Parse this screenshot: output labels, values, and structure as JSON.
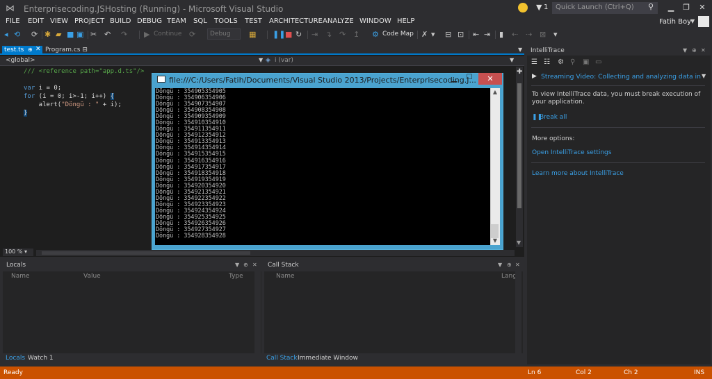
{
  "window": {
    "title": "Enterprisecoding.JSHosting (Running) - Microsoft Visual Studio",
    "notification_count": "1",
    "quick_launch_placeholder": "Quick Launch (Ctrl+Q)",
    "user": "Fatih Boy"
  },
  "menu": [
    "FILE",
    "EDIT",
    "VIEW",
    "PROJECT",
    "BUILD",
    "DEBUG",
    "TEAM",
    "SQL",
    "TOOLS",
    "TEST",
    "ARCHITECTURE",
    "ANALYZE",
    "WINDOW",
    "HELP"
  ],
  "toolbar": {
    "continue_label": "Continue",
    "config_value": "Debug",
    "code_map_label": "Code Map"
  },
  "editor": {
    "tabs": [
      {
        "label": "test.ts",
        "active": true
      },
      {
        "label": "Program.cs",
        "active": false
      }
    ],
    "nav_left": "<global>",
    "nav_right": "i (var)",
    "code_lines": [
      "/// <reference path=\"app.d.ts\"/>",
      "",
      "var i = 0;",
      "for (i = 0; i>-1; i++) {",
      "    alert(\"Döngü : \" + i);",
      "}"
    ],
    "zoom": "100 %"
  },
  "console": {
    "title": "file:///C:/Users/Fatih/Documents/Visual Studio 2013/Projects/Enterprisecoding.J...",
    "lines": [
      "Döngü : 354905354905",
      "Döngü : 354906354906",
      "Döngü : 354907354907",
      "Döngü : 354908354908",
      "Döngü : 354909354909",
      "Döngü : 354910354910",
      "Döngü : 354911354911",
      "Döngü : 354912354912",
      "Döngü : 354913354913",
      "Döngü : 354914354914",
      "Döngü : 354915354915",
      "Döngü : 354916354916",
      "Döngü : 354917354917",
      "Döngü : 354918354918",
      "Döngü : 354919354919",
      "Döngü : 354920354920",
      "Döngü : 354921354921",
      "Döngü : 354922354922",
      "Döngü : 354923354923",
      "Döngü : 354924354924",
      "Döngü : 354925354925",
      "Döngü : 354926354926",
      "Döngü : 354927354927",
      "Döngü : 354928354928"
    ]
  },
  "locals": {
    "title": "Locals",
    "columns": [
      "Name",
      "Value",
      "Type"
    ],
    "tabs": [
      "Locals",
      "Watch 1"
    ]
  },
  "callstack": {
    "title": "Call Stack",
    "columns": [
      "Name",
      "Lang"
    ],
    "tabs": [
      "Call Stack",
      "Immediate Window"
    ]
  },
  "intellitrace": {
    "title": "IntelliTrace",
    "video_link": "Streaming Video: Collecting and analyzing data in produc",
    "message": "To view IntelliTrace data, you must break execution of your application.",
    "break_all": "Break all",
    "more_options": "More options:",
    "open_settings": "Open IntelliTrace settings",
    "learn_more": "Learn more about IntelliTrace"
  },
  "status": {
    "state": "Ready",
    "ln": "Ln 6",
    "col": "Col 2",
    "ch": "Ch 2",
    "mode": "INS"
  },
  "colors": {
    "accent": "#007acc",
    "status_bar": "#ca5100",
    "link": "#3aa0e6",
    "console_frame": "#4aa3cf",
    "close_button": "#c75050"
  }
}
